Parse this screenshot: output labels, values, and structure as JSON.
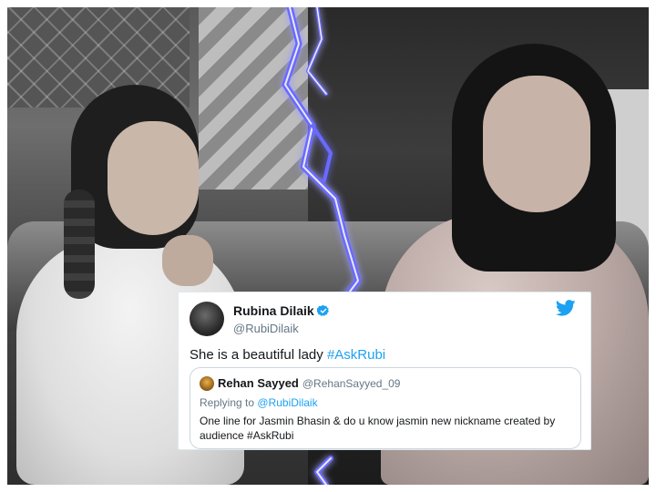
{
  "tweet": {
    "display_name": "Rubina Dilaik",
    "handle": "@RubiDilaik",
    "text_plain": "She is a beautiful lady ",
    "text_hashtag": "#AskRubi",
    "icons": {
      "verified": "verified-badge-icon",
      "brand": "twitter-bird-icon"
    },
    "accent_color": "#1da1f2"
  },
  "quoted_tweet": {
    "display_name": "Rehan Sayyed",
    "handle": "@RehanSayyed_09",
    "replying_prefix": "Replying to ",
    "replying_to": "@RubiDilaik",
    "text": "One line for Jasmin Bhasin & do u know jasmin new nickname created by audience  #AskRubi"
  }
}
